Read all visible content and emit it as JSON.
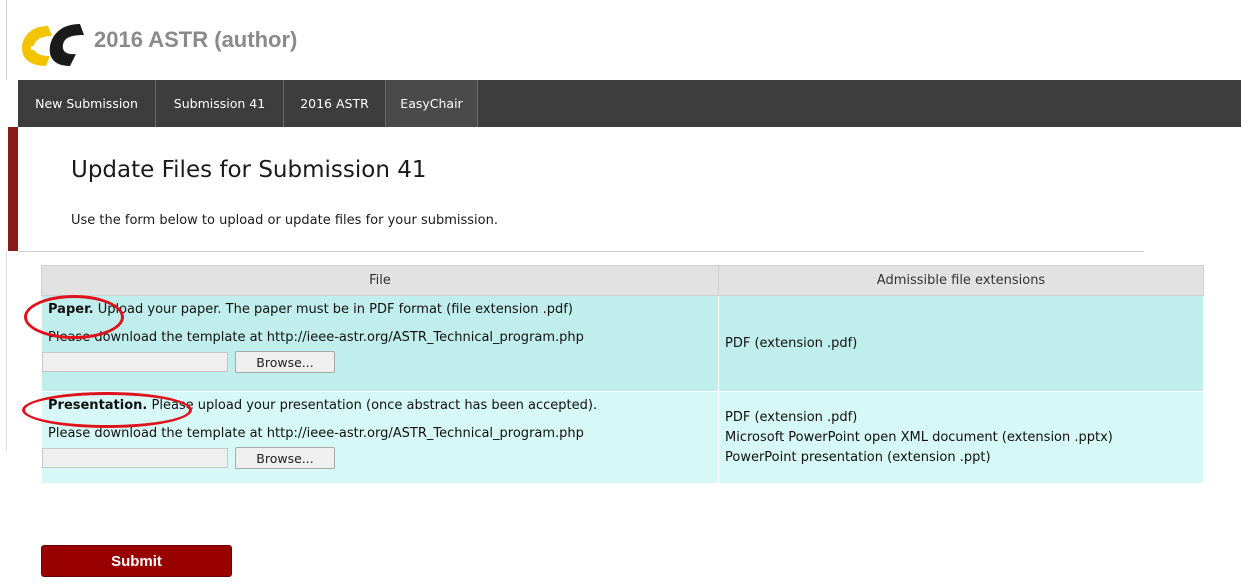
{
  "header": {
    "title": "2016 ASTR (author)",
    "logo_icon": "easychair-logo-icon",
    "colors": {
      "logo_yellow": "#f5c400",
      "logo_black": "#1a1a1a",
      "title": "#8a8a8a"
    }
  },
  "menu": {
    "items": [
      {
        "label": "New Submission"
      },
      {
        "label": "Submission 41"
      },
      {
        "label": "2016 ASTR"
      },
      {
        "label": "EasyChair"
      }
    ],
    "background": "#3d3d3d"
  },
  "page": {
    "title": "Update Files for Submission 41",
    "subtitle": "Use the form below to upload or update files for your submission.",
    "accent": "#8b1a1a"
  },
  "table": {
    "headers": {
      "file": "File",
      "extensions": "Admissible file extensions"
    },
    "rows": [
      {
        "label": "Paper.",
        "text": " Upload your paper. The paper must be in PDF format (file extension .pdf)",
        "template": "Please download the template at http://ieee-astr.org/ASTR_Technical_program.php",
        "browse": "Browse...",
        "extensions": [
          "PDF (extension .pdf)"
        ]
      },
      {
        "label": "Presentation.",
        "text": " Please upload your presentation (once abstract has been accepted).",
        "template": "Please download the template at http://ieee-astr.org/ASTR_Technical_program.php",
        "browse": "Browse...",
        "extensions": [
          "PDF (extension .pdf)",
          "Microsoft PowerPoint open XML document (extension .pptx)",
          "PowerPoint presentation (extension .ppt)"
        ]
      }
    ],
    "colors": {
      "paper_row": "#bfeeec",
      "presentation_row": "#d6f8f6",
      "header": "#e2e2e2"
    }
  },
  "submit": {
    "label": "Submit",
    "color": "#990000"
  },
  "annotation": {
    "color": "#e0111b"
  }
}
